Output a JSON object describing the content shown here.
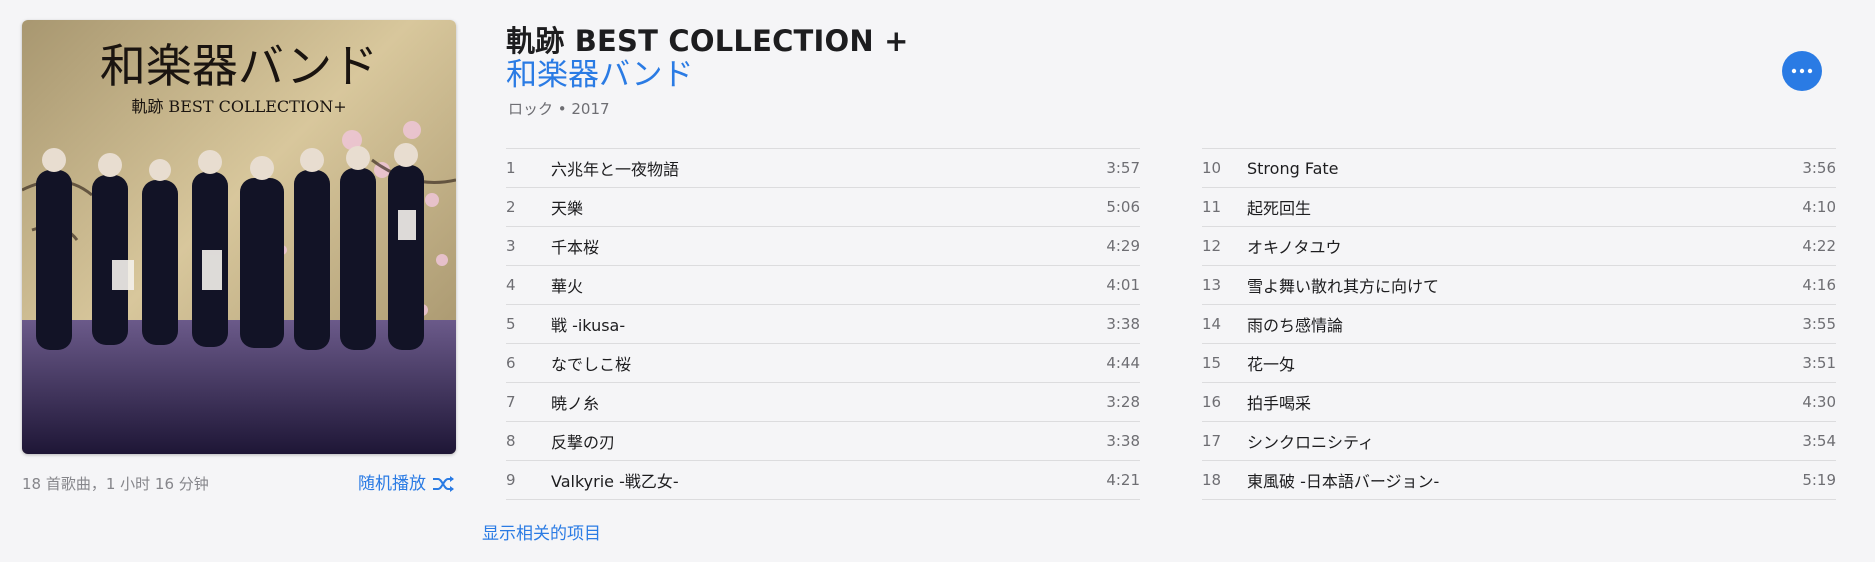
{
  "album": {
    "title": "軌跡 BEST COLLECTION +",
    "artist": "和楽器バンド",
    "genre_year": "ロック • 2017",
    "art_logo": "和楽器バンド",
    "art_subtitle": "軌跡 BEST COLLECTION+"
  },
  "summary": {
    "count_duration": "18 首歌曲，1 小时 16 分钟",
    "shuffle_label": "随机播放"
  },
  "related_label": "显示相关的项目",
  "tracks_left": [
    {
      "num": "1",
      "name": "六兆年と一夜物語",
      "duration": "3:57"
    },
    {
      "num": "2",
      "name": "天樂",
      "duration": "5:06"
    },
    {
      "num": "3",
      "name": "千本桜",
      "duration": "4:29"
    },
    {
      "num": "4",
      "name": "華火",
      "duration": "4:01"
    },
    {
      "num": "5",
      "name": "戦 -ikusa-",
      "duration": "3:38"
    },
    {
      "num": "6",
      "name": "なでしこ桜",
      "duration": "4:44"
    },
    {
      "num": "7",
      "name": "暁ノ糸",
      "duration": "3:28"
    },
    {
      "num": "8",
      "name": "反撃の刃",
      "duration": "3:38"
    },
    {
      "num": "9",
      "name": "Valkyrie -戦乙女-",
      "duration": "4:21"
    }
  ],
  "tracks_right": [
    {
      "num": "10",
      "name": "Strong Fate",
      "duration": "3:56"
    },
    {
      "num": "11",
      "name": "起死回生",
      "duration": "4:10"
    },
    {
      "num": "12",
      "name": "オキノタユウ",
      "duration": "4:22"
    },
    {
      "num": "13",
      "name": "雪よ舞い散れ其方に向けて",
      "duration": "4:16"
    },
    {
      "num": "14",
      "name": "雨のち感情論",
      "duration": "3:55"
    },
    {
      "num": "15",
      "name": "花一匁",
      "duration": "3:51"
    },
    {
      "num": "16",
      "name": "拍手喝采",
      "duration": "4:30"
    },
    {
      "num": "17",
      "name": "シンクロニシティ",
      "duration": "3:54"
    },
    {
      "num": "18",
      "name": "東風破 -日本語バージョン-",
      "duration": "5:19"
    }
  ],
  "icons": {
    "shuffle": "shuffle-icon",
    "more": "ellipsis-icon"
  },
  "colors": {
    "accent": "#2a7be4",
    "background": "#f5f5f7",
    "secondary_text": "#6e6e73"
  }
}
